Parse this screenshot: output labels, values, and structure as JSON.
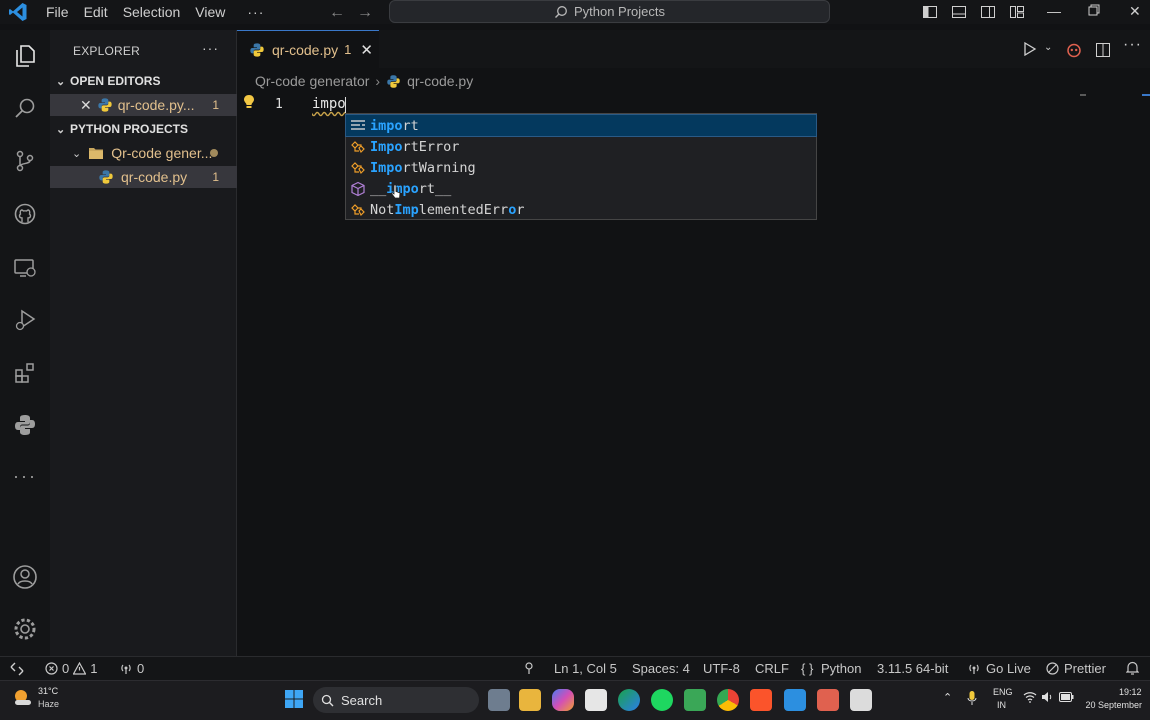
{
  "titlebar": {
    "menu": [
      "File",
      "Edit",
      "Selection",
      "View"
    ],
    "more": "···",
    "search_text": "Python Projects"
  },
  "sidebar": {
    "title": "EXPLORER",
    "more": "···",
    "open_editors_label": "OPEN EDITORS",
    "open_editor_item": {
      "name": "qr-code.py...",
      "badge": "1"
    },
    "project_label": "PYTHON PROJECTS",
    "folder": {
      "name": "Qr-code gener..."
    },
    "file": {
      "name": "qr-code.py",
      "badge": "1"
    }
  },
  "tab": {
    "label": "qr-code.py",
    "badge": "1"
  },
  "breadcrumb": {
    "folder": "Qr-code generator",
    "file": "qr-code.py"
  },
  "editor": {
    "line_number": "1",
    "code": "impo"
  },
  "suggest": {
    "items": [
      {
        "pre": "",
        "match": "impo",
        "post": "rt",
        "kind": "keyword"
      },
      {
        "pre": "",
        "match": "Impo",
        "post": "rtError",
        "kind": "class"
      },
      {
        "pre": "",
        "match": "Impo",
        "post": "rtWarning",
        "kind": "class"
      },
      {
        "pre": "__",
        "match": "impo",
        "post": "rt__",
        "kind": "module"
      },
      {
        "pre": "Not",
        "match": "Imp",
        "post": "lementedErr",
        "match2": "o",
        "post2": "r",
        "kind": "class"
      }
    ]
  },
  "statusbar": {
    "errors": "0",
    "warnings": "1",
    "ports": "0",
    "position": "Ln 1, Col 5",
    "spaces": "Spaces: 4",
    "encoding": "UTF-8",
    "eol": "CRLF",
    "language": "Python",
    "version": "3.11.5 64-bit",
    "golive": "Go Live",
    "prettier": "Prettier"
  },
  "taskbar": {
    "temp": "31°C",
    "weather": "Haze",
    "search": "Search",
    "lang1": "ENG",
    "lang2": "IN",
    "time": "19:12",
    "date": "20 September"
  },
  "colors": {
    "accent": "#3a78c9",
    "modified": "#e2c08d",
    "match": "#2aa3ff"
  }
}
